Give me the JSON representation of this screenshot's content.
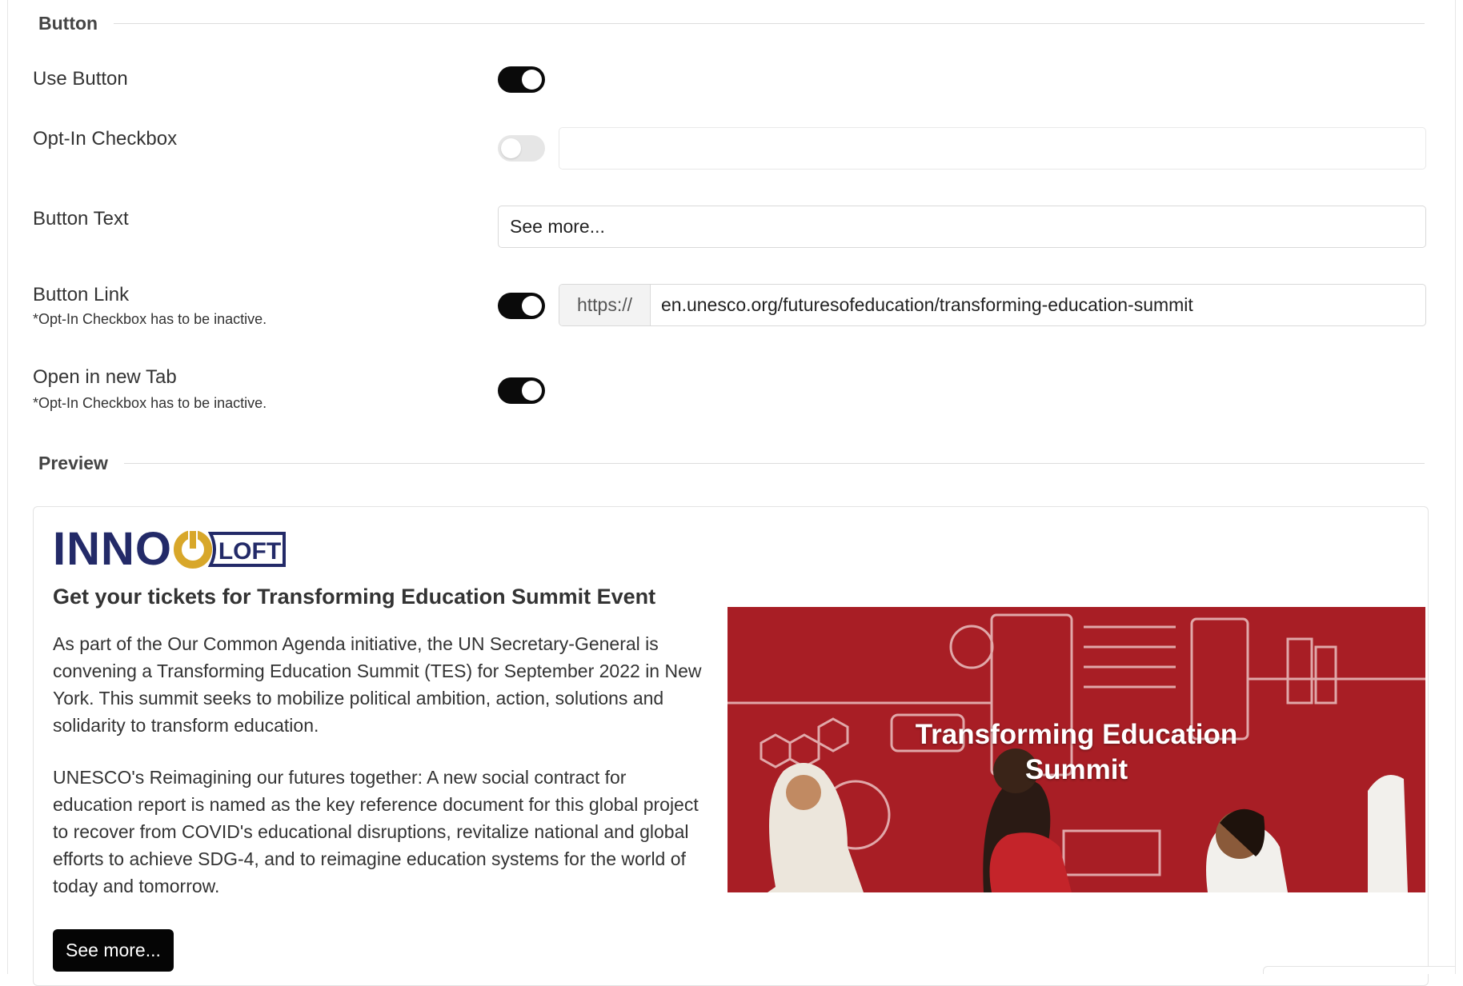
{
  "button_section": {
    "title": "Button",
    "use_button": {
      "label": "Use Button",
      "enabled": true
    },
    "opt_in": {
      "label": "Opt-In Checkbox",
      "enabled": false,
      "value": ""
    },
    "button_text": {
      "label": "Button Text",
      "value": "See more..."
    },
    "button_link": {
      "label": "Button Link",
      "hint": "*Opt-In Checkbox has to be inactive.",
      "enabled": true,
      "prefix": "https://",
      "value": "en.unesco.org/futuresofeducation/transforming-education-summit"
    },
    "new_tab": {
      "label": "Open in new Tab",
      "hint": "*Opt-In Checkbox has to be inactive.",
      "enabled": true
    }
  },
  "preview_section": {
    "title": "Preview",
    "logo": {
      "word": "INNO",
      "suffix": "LOFT"
    },
    "headline": "Get your tickets for Transforming Education Summit Event",
    "paragraph_1": "As part of the Our Common Agenda initiative, the UN Secretary-General is convening a Transforming Education Summit (TES) for September 2022 in New York. This summit seeks to mobilize political ambition, action, solutions and solidarity to transform education.",
    "paragraph_2": "UNESCO's Reimagining our futures together: A new social contract for education report is named as the key reference document for this global project to recover from COVID's educational disruptions, revitalize national and global efforts to achieve SDG-4, and to reimagine education systems for the world of today and tomorrow.",
    "button_label": "See more...",
    "image_title_line_1": "Transforming Education",
    "image_title_line_2": "Summit"
  },
  "colors": {
    "toggle_on": "#0a0a0a",
    "toggle_off": "#e6e6e6",
    "logo_navy": "#232a68",
    "logo_gold": "#d8a72a",
    "image_red": "#a81e25"
  }
}
